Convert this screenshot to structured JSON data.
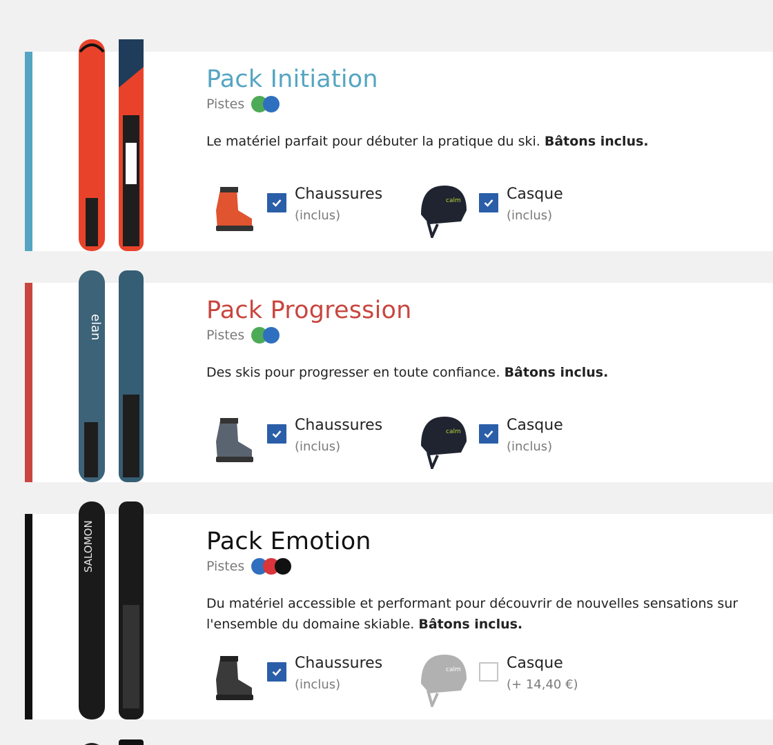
{
  "packs": [
    {
      "title": "Pack Initiation",
      "accent": "#55a5c2",
      "level_label": "Pistes",
      "level_colors": [
        "#4daa57",
        "#2f6fbf"
      ],
      "desc_text": "Le matériel parfait pour débuter la pratique du ski.",
      "desc_bold": "Bâtons inclus.",
      "ski_colors": [
        "#e8432a",
        "#e8432a"
      ],
      "options": [
        {
          "name": "Chaussures",
          "price": "(inclus)",
          "checked": true,
          "icon": "boot-icon",
          "color": "#e0542f"
        },
        {
          "name": "Casque",
          "price": "(inclus)",
          "checked": true,
          "icon": "helmet-icon",
          "color": "#1f2430"
        }
      ]
    },
    {
      "title": "Pack Progression",
      "accent": "#c8463f",
      "level_label": "Pistes",
      "level_colors": [
        "#4daa57",
        "#2f6fbf"
      ],
      "desc_text": "Des skis pour progresser en toute confiance.",
      "desc_bold": "Bâtons inclus.",
      "ski_colors": [
        "#3d6378",
        "#355d73"
      ],
      "options": [
        {
          "name": "Chaussures",
          "price": "(inclus)",
          "checked": true,
          "icon": "boot-icon",
          "color": "#5a6470"
        },
        {
          "name": "Casque",
          "price": "(inclus)",
          "checked": true,
          "icon": "helmet-icon",
          "color": "#1f2430"
        }
      ]
    },
    {
      "title": "Pack Emotion",
      "accent": "#111111",
      "level_label": "Pistes",
      "level_colors": [
        "#2f6fbf",
        "#d9353a",
        "#111111"
      ],
      "desc_text": "Du matériel accessible et performant pour découvrir de nouvelles sensations sur l'ensemble du domaine skiable.",
      "desc_bold": "Bâtons inclus.",
      "ski_colors": [
        "#1a1a1a",
        "#1a1a1a"
      ],
      "options": [
        {
          "name": "Chaussures",
          "price": "(inclus)",
          "checked": true,
          "icon": "boot-icon",
          "color": "#3a3a3a"
        },
        {
          "name": "Casque",
          "price": "(+ 14,40 €)",
          "checked": false,
          "icon": "helmet-icon",
          "color": "#555555"
        }
      ]
    }
  ]
}
